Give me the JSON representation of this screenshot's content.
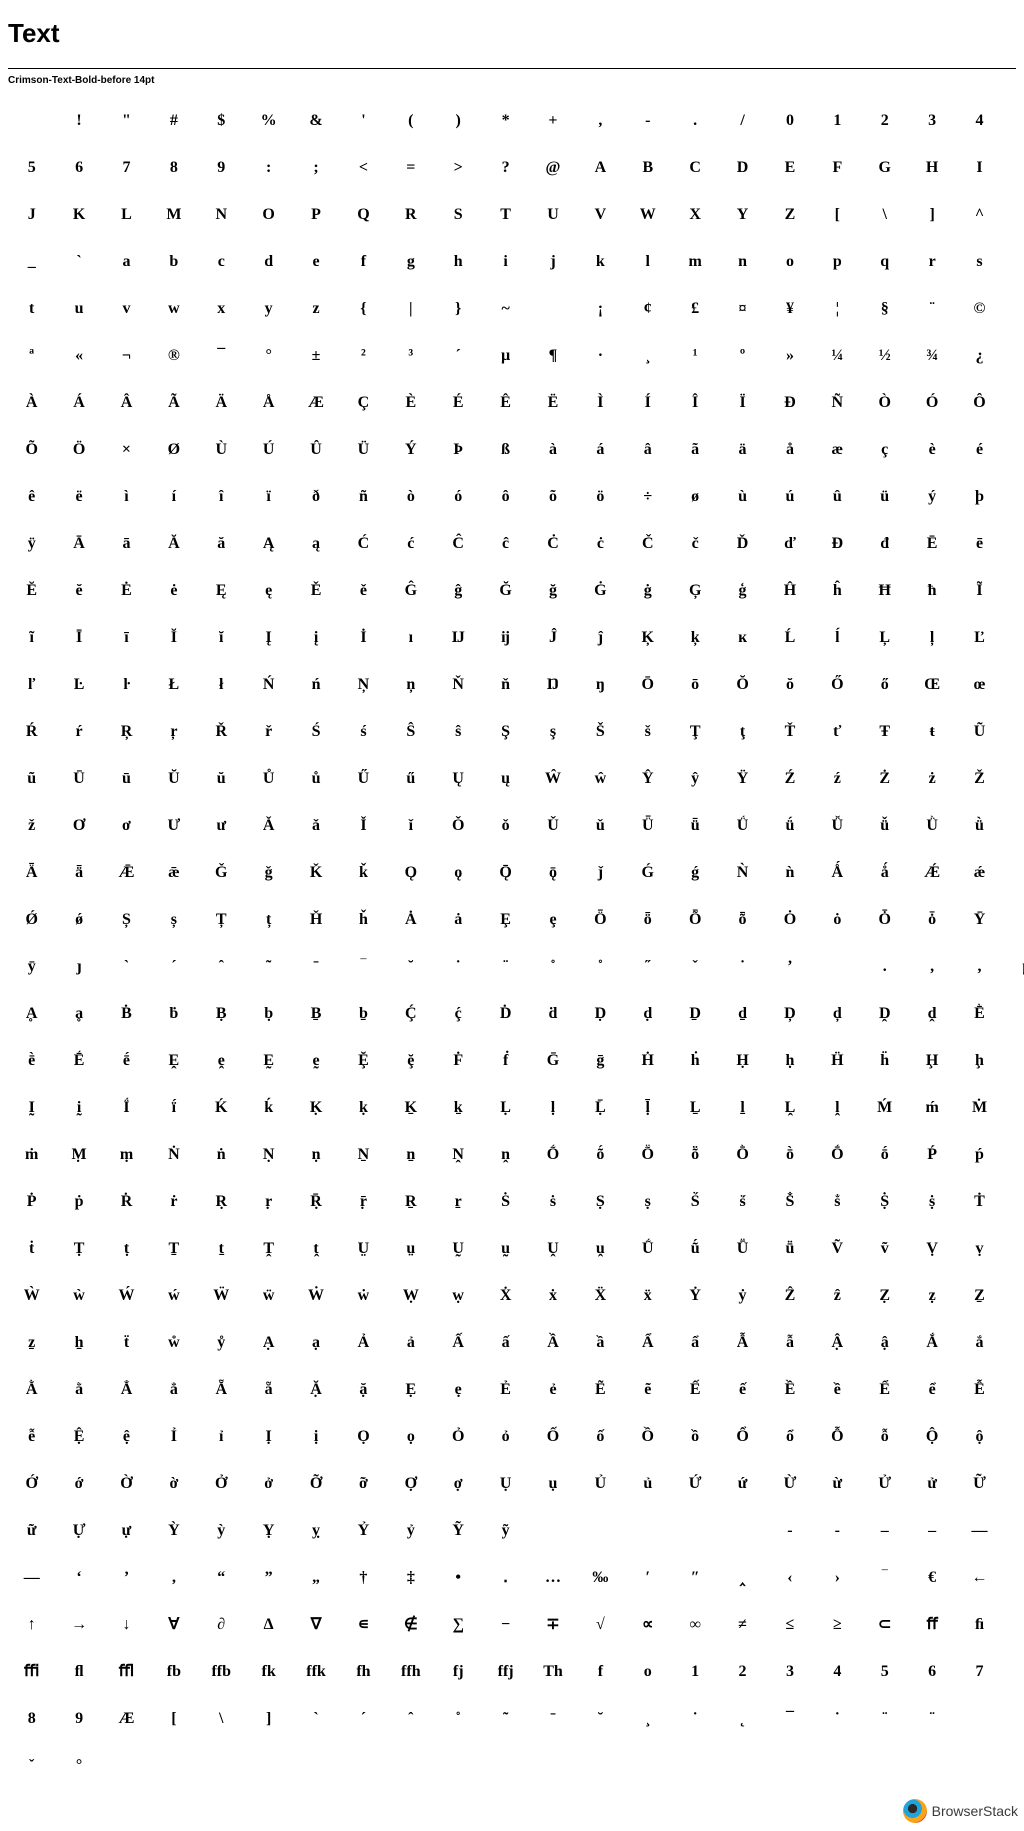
{
  "header": {
    "title": "Text",
    "sample_label": "Crimson-Text-Bold-before 14pt"
  },
  "glyph_rows": [
    [
      " ",
      "!",
      "\"",
      "#",
      "$",
      "%",
      "&",
      "'",
      "(",
      ")",
      "*",
      "+",
      ",",
      "-",
      ".",
      "/",
      "0",
      "1",
      "2",
      "3",
      "4"
    ],
    [
      "5",
      "6",
      "7",
      "8",
      "9",
      ":",
      ";",
      "<",
      "=",
      ">",
      "?",
      "@",
      "A",
      "B",
      "C",
      "D",
      "E",
      "F",
      "G",
      "H",
      "I"
    ],
    [
      "J",
      "K",
      "L",
      "M",
      "N",
      "O",
      "P",
      "Q",
      "R",
      "S",
      "T",
      "U",
      "V",
      "W",
      "X",
      "Y",
      "Z",
      "[",
      "\\",
      "]",
      "^"
    ],
    [
      "_",
      "`",
      "a",
      "b",
      "c",
      "d",
      "e",
      "f",
      "g",
      "h",
      "i",
      "j",
      "k",
      "l",
      "m",
      "n",
      "o",
      "p",
      "q",
      "r",
      "s"
    ],
    [
      "t",
      "u",
      "v",
      "w",
      "x",
      "y",
      "z",
      "{",
      "|",
      "}",
      "~",
      " ",
      "¡",
      "¢",
      "£",
      "¤",
      "¥",
      "¦",
      "§",
      "¨",
      "©"
    ],
    [
      "ª",
      "«",
      "¬",
      "®",
      "¯",
      "°",
      "±",
      "²",
      "³",
      "´",
      "µ",
      "¶",
      "·",
      "¸",
      "¹",
      "º",
      "»",
      "¼",
      "½",
      "¾",
      "¿"
    ],
    [
      "À",
      "Á",
      "Â",
      "Ã",
      "Ä",
      "Å",
      "Æ",
      "Ç",
      "È",
      "É",
      "Ê",
      "Ë",
      "Ì",
      "Í",
      "Î",
      "Ï",
      "Ð",
      "Ñ",
      "Ò",
      "Ó",
      "Ô"
    ],
    [
      "Õ",
      "Ö",
      "×",
      "Ø",
      "Ù",
      "Ú",
      "Û",
      "Ü",
      "Ý",
      "Þ",
      "ß",
      "à",
      "á",
      "â",
      "ã",
      "ä",
      "å",
      "æ",
      "ç",
      "è",
      "é"
    ],
    [
      "ê",
      "ë",
      "ì",
      "í",
      "î",
      "ï",
      "ð",
      "ñ",
      "ò",
      "ó",
      "ô",
      "õ",
      "ö",
      "÷",
      "ø",
      "ù",
      "ú",
      "û",
      "ü",
      "ý",
      "þ"
    ],
    [
      "ÿ",
      "Ā",
      "ā",
      "Ă",
      "ă",
      "Ą",
      "ą",
      "Ć",
      "ć",
      "Ĉ",
      "ĉ",
      "Ċ",
      "ċ",
      "Č",
      "č",
      "Ď",
      "ď",
      "Đ",
      "đ",
      "Ē",
      "ē"
    ],
    [
      "Ĕ",
      "ĕ",
      "Ė",
      "ė",
      "Ę",
      "ę",
      "Ě",
      "ě",
      "Ĝ",
      "ĝ",
      "Ğ",
      "ğ",
      "Ġ",
      "ġ",
      "Ģ",
      "ģ",
      "Ĥ",
      "ĥ",
      "Ħ",
      "ħ",
      "Ĩ"
    ],
    [
      "ĩ",
      "Ī",
      "ī",
      "Ĭ",
      "ĭ",
      "Į",
      "į",
      "İ",
      "ı",
      "Ĳ",
      "ĳ",
      "Ĵ",
      "ĵ",
      "Ķ",
      "ķ",
      "ĸ",
      "Ĺ",
      "ĺ",
      "Ļ",
      "ļ",
      "Ľ"
    ],
    [
      "ľ",
      "Ŀ",
      "ŀ",
      "Ł",
      "ł",
      "Ń",
      "ń",
      "Ņ",
      "ņ",
      "Ň",
      "ň",
      "Ŋ",
      "ŋ",
      "Ō",
      "ō",
      "Ŏ",
      "ŏ",
      "Ő",
      "ő",
      "Œ",
      "œ"
    ],
    [
      "Ŕ",
      "ŕ",
      "Ŗ",
      "ŗ",
      "Ř",
      "ř",
      "Ś",
      "ś",
      "Ŝ",
      "ŝ",
      "Ş",
      "ş",
      "Š",
      "š",
      "Ţ",
      "ţ",
      "Ť",
      "ť",
      "Ŧ",
      "ŧ",
      "Ũ"
    ],
    [
      "ũ",
      "Ū",
      "ū",
      "Ŭ",
      "ŭ",
      "Ů",
      "ů",
      "Ű",
      "ű",
      "Ų",
      "ų",
      "Ŵ",
      "ŵ",
      "Ŷ",
      "ŷ",
      "Ÿ",
      "Ź",
      "ź",
      "Ż",
      "ż",
      "Ž"
    ],
    [
      "ž",
      "Ơ",
      "ơ",
      "Ư",
      "ư",
      "Ǎ",
      "ǎ",
      "Ǐ",
      "ǐ",
      "Ǒ",
      "ǒ",
      "Ǔ",
      "ǔ",
      "Ǖ",
      "ǖ",
      "Ǘ",
      "ǘ",
      "Ǚ",
      "ǚ",
      "Ǜ",
      "ǜ"
    ],
    [
      "Ǟ",
      "ǟ",
      "Ǣ",
      "ǣ",
      "Ǧ",
      "ǧ",
      "Ǩ",
      "ǩ",
      "Ǫ",
      "ǫ",
      "Ǭ",
      "ǭ",
      "ǰ",
      "Ǵ",
      "ǵ",
      "Ǹ",
      "ǹ",
      "Ǻ",
      "ǻ",
      "Ǽ",
      "ǽ"
    ],
    [
      "Ǿ",
      "ǿ",
      "Ș",
      "ș",
      "Ț",
      "ț",
      "Ȟ",
      "ȟ",
      "Ȧ",
      "ȧ",
      "Ȩ",
      "ȩ",
      "Ȫ",
      "ȫ",
      "Ȭ",
      "ȭ",
      "Ȯ",
      "ȯ",
      "Ȱ",
      "ȱ",
      "Ȳ"
    ],
    [
      "ȳ",
      "ȷ",
      "ˋ",
      "ˊ",
      "ˆ",
      "˜",
      "ˉ",
      "‾",
      "˘",
      "˙",
      "¨",
      "˚",
      "˚",
      "˝",
      "ˇ",
      "˙",
      "ʼ",
      " ",
      ".",
      ",",
      ",",
      "µ"
    ],
    [
      "Ḁ",
      "ḁ",
      "Ḃ",
      "ḃ",
      "Ḅ",
      "ḅ",
      "Ḇ",
      "ḇ",
      "Ḉ",
      "ḉ",
      "Ḋ",
      "ḋ",
      "Ḍ",
      "ḍ",
      "Ḏ",
      "ḏ",
      "Ḑ",
      "ḑ",
      "Ḓ",
      "ḓ",
      "Ḕ"
    ],
    [
      "ḕ",
      "Ḗ",
      "ḗ",
      "Ḙ",
      "ḙ",
      "Ḛ",
      "ḛ",
      "Ḝ",
      "ḝ",
      "Ḟ",
      "ḟ",
      "Ḡ",
      "ḡ",
      "Ḣ",
      "ḣ",
      "Ḥ",
      "ḥ",
      "Ḧ",
      "ḧ",
      "Ḩ",
      "ḩ"
    ],
    [
      "Ḭ",
      "ḭ",
      "Ḯ",
      "ḯ",
      "Ḱ",
      "ḱ",
      "Ḳ",
      "ḳ",
      "Ḵ",
      "ḵ",
      "Ḷ",
      "ḷ",
      "Ḹ",
      "ḹ",
      "Ḻ",
      "ḻ",
      "Ḽ",
      "ḽ",
      "Ḿ",
      "ḿ",
      "Ṁ"
    ],
    [
      "ṁ",
      "Ṃ",
      "ṃ",
      "Ṅ",
      "ṅ",
      "Ṇ",
      "ṇ",
      "Ṉ",
      "ṉ",
      "Ṋ",
      "ṋ",
      "Ṍ",
      "ṍ",
      "Ṏ",
      "ṏ",
      "Ṑ",
      "ṑ",
      "Ṓ",
      "ṓ",
      "Ṕ",
      "ṕ"
    ],
    [
      "Ṗ",
      "ṗ",
      "Ṙ",
      "ṙ",
      "Ṛ",
      "ṛ",
      "Ṝ",
      "ṝ",
      "Ṟ",
      "ṟ",
      "Ṡ",
      "ṡ",
      "Ṣ",
      "ṣ",
      "Ṥ",
      "ṥ",
      "Ṧ",
      "ṧ",
      "Ṩ",
      "ṩ",
      "Ṫ"
    ],
    [
      "ṫ",
      "Ṭ",
      "ṭ",
      "Ṯ",
      "ṯ",
      "Ṱ",
      "ṱ",
      "Ṳ",
      "ṳ",
      "Ṵ",
      "ṵ",
      "Ṷ",
      "ṷ",
      "Ṹ",
      "ṹ",
      "Ṻ",
      "ṻ",
      "Ṽ",
      "ṽ",
      "Ṿ",
      "ṿ"
    ],
    [
      "Ẁ",
      "ẁ",
      "Ẃ",
      "ẃ",
      "Ẅ",
      "ẅ",
      "Ẇ",
      "ẇ",
      "Ẉ",
      "ẉ",
      "Ẋ",
      "ẋ",
      "Ẍ",
      "ẍ",
      "Ẏ",
      "ẏ",
      "Ẑ",
      "ẑ",
      "Ẓ",
      "ẓ",
      "Ẕ"
    ],
    [
      "ẕ",
      "ẖ",
      "ẗ",
      "ẘ",
      "ẙ",
      "Ạ",
      "ạ",
      "Ả",
      "ả",
      "Ấ",
      "ấ",
      "Ầ",
      "ầ",
      "Ẩ",
      "ẩ",
      "Ẫ",
      "ẫ",
      "Ậ",
      "ậ",
      "Ắ",
      "ắ"
    ],
    [
      "Ằ",
      "ằ",
      "Ẳ",
      "ẳ",
      "Ẵ",
      "ẵ",
      "Ặ",
      "ặ",
      "Ẹ",
      "ẹ",
      "Ẻ",
      "ẻ",
      "Ẽ",
      "ẽ",
      "Ế",
      "ế",
      "Ề",
      "ề",
      "Ể",
      "ể",
      "Ễ"
    ],
    [
      "ễ",
      "Ệ",
      "ệ",
      "Ỉ",
      "ỉ",
      "Ị",
      "ị",
      "Ọ",
      "ọ",
      "Ỏ",
      "ỏ",
      "Ố",
      "ố",
      "Ồ",
      "ồ",
      "Ổ",
      "ổ",
      "Ỗ",
      "ỗ",
      "Ộ",
      "ộ"
    ],
    [
      "Ớ",
      "ớ",
      "Ờ",
      "ờ",
      "Ở",
      "ở",
      "Ỡ",
      "ỡ",
      "Ợ",
      "ợ",
      "Ụ",
      "ụ",
      "Ủ",
      "ủ",
      "Ứ",
      "ứ",
      "Ừ",
      "ừ",
      "Ử",
      "ử",
      "Ữ"
    ],
    [
      "ữ",
      "Ự",
      "ự",
      "Ỳ",
      "ỳ",
      "Ỵ",
      "ỵ",
      "Ỷ",
      "ỷ",
      "Ỹ",
      "ỹ",
      " ",
      " ",
      " ",
      " ",
      " ",
      "‐",
      "‑",
      "‒",
      "–",
      "—"
    ],
    [
      "―",
      "‘",
      "’",
      "‚",
      "“",
      "”",
      "„",
      "†",
      "‡",
      "•",
      "․",
      "…",
      "‰",
      "′",
      "″",
      "‸",
      "‹",
      "›",
      "‾",
      "€",
      "←"
    ],
    [
      "↑",
      "→",
      "↓",
      "∀",
      "∂",
      "∆",
      "∇",
      "∊",
      "∉",
      "∑",
      "−",
      "∓",
      "√",
      "∝",
      "∞",
      "≠",
      "≤",
      "≥",
      "⊂",
      "ﬀ",
      "ﬁ"
    ],
    [
      "ﬃ",
      "ﬂ",
      "ﬄ",
      "fb",
      "ffb",
      "fk",
      "ffk",
      "fh",
      "ffh",
      "fj",
      "ffj",
      "Th",
      "f",
      "o",
      "1",
      "2",
      "3",
      "4",
      "5",
      "6",
      "7"
    ],
    [
      "8",
      "9",
      "Æ",
      "[",
      "\\",
      "]",
      "ˋ",
      "ˊ",
      "ˆ",
      "˚",
      "˜",
      "ˉ",
      "˘",
      "¸",
      "˙",
      "˛",
      "¯",
      "˙",
      "¨",
      "¨"
    ],
    [
      "ˇ",
      "°"
    ]
  ],
  "watermark": {
    "text": "BrowserStack",
    "logo_icon": "browserstack-logo-icon"
  }
}
